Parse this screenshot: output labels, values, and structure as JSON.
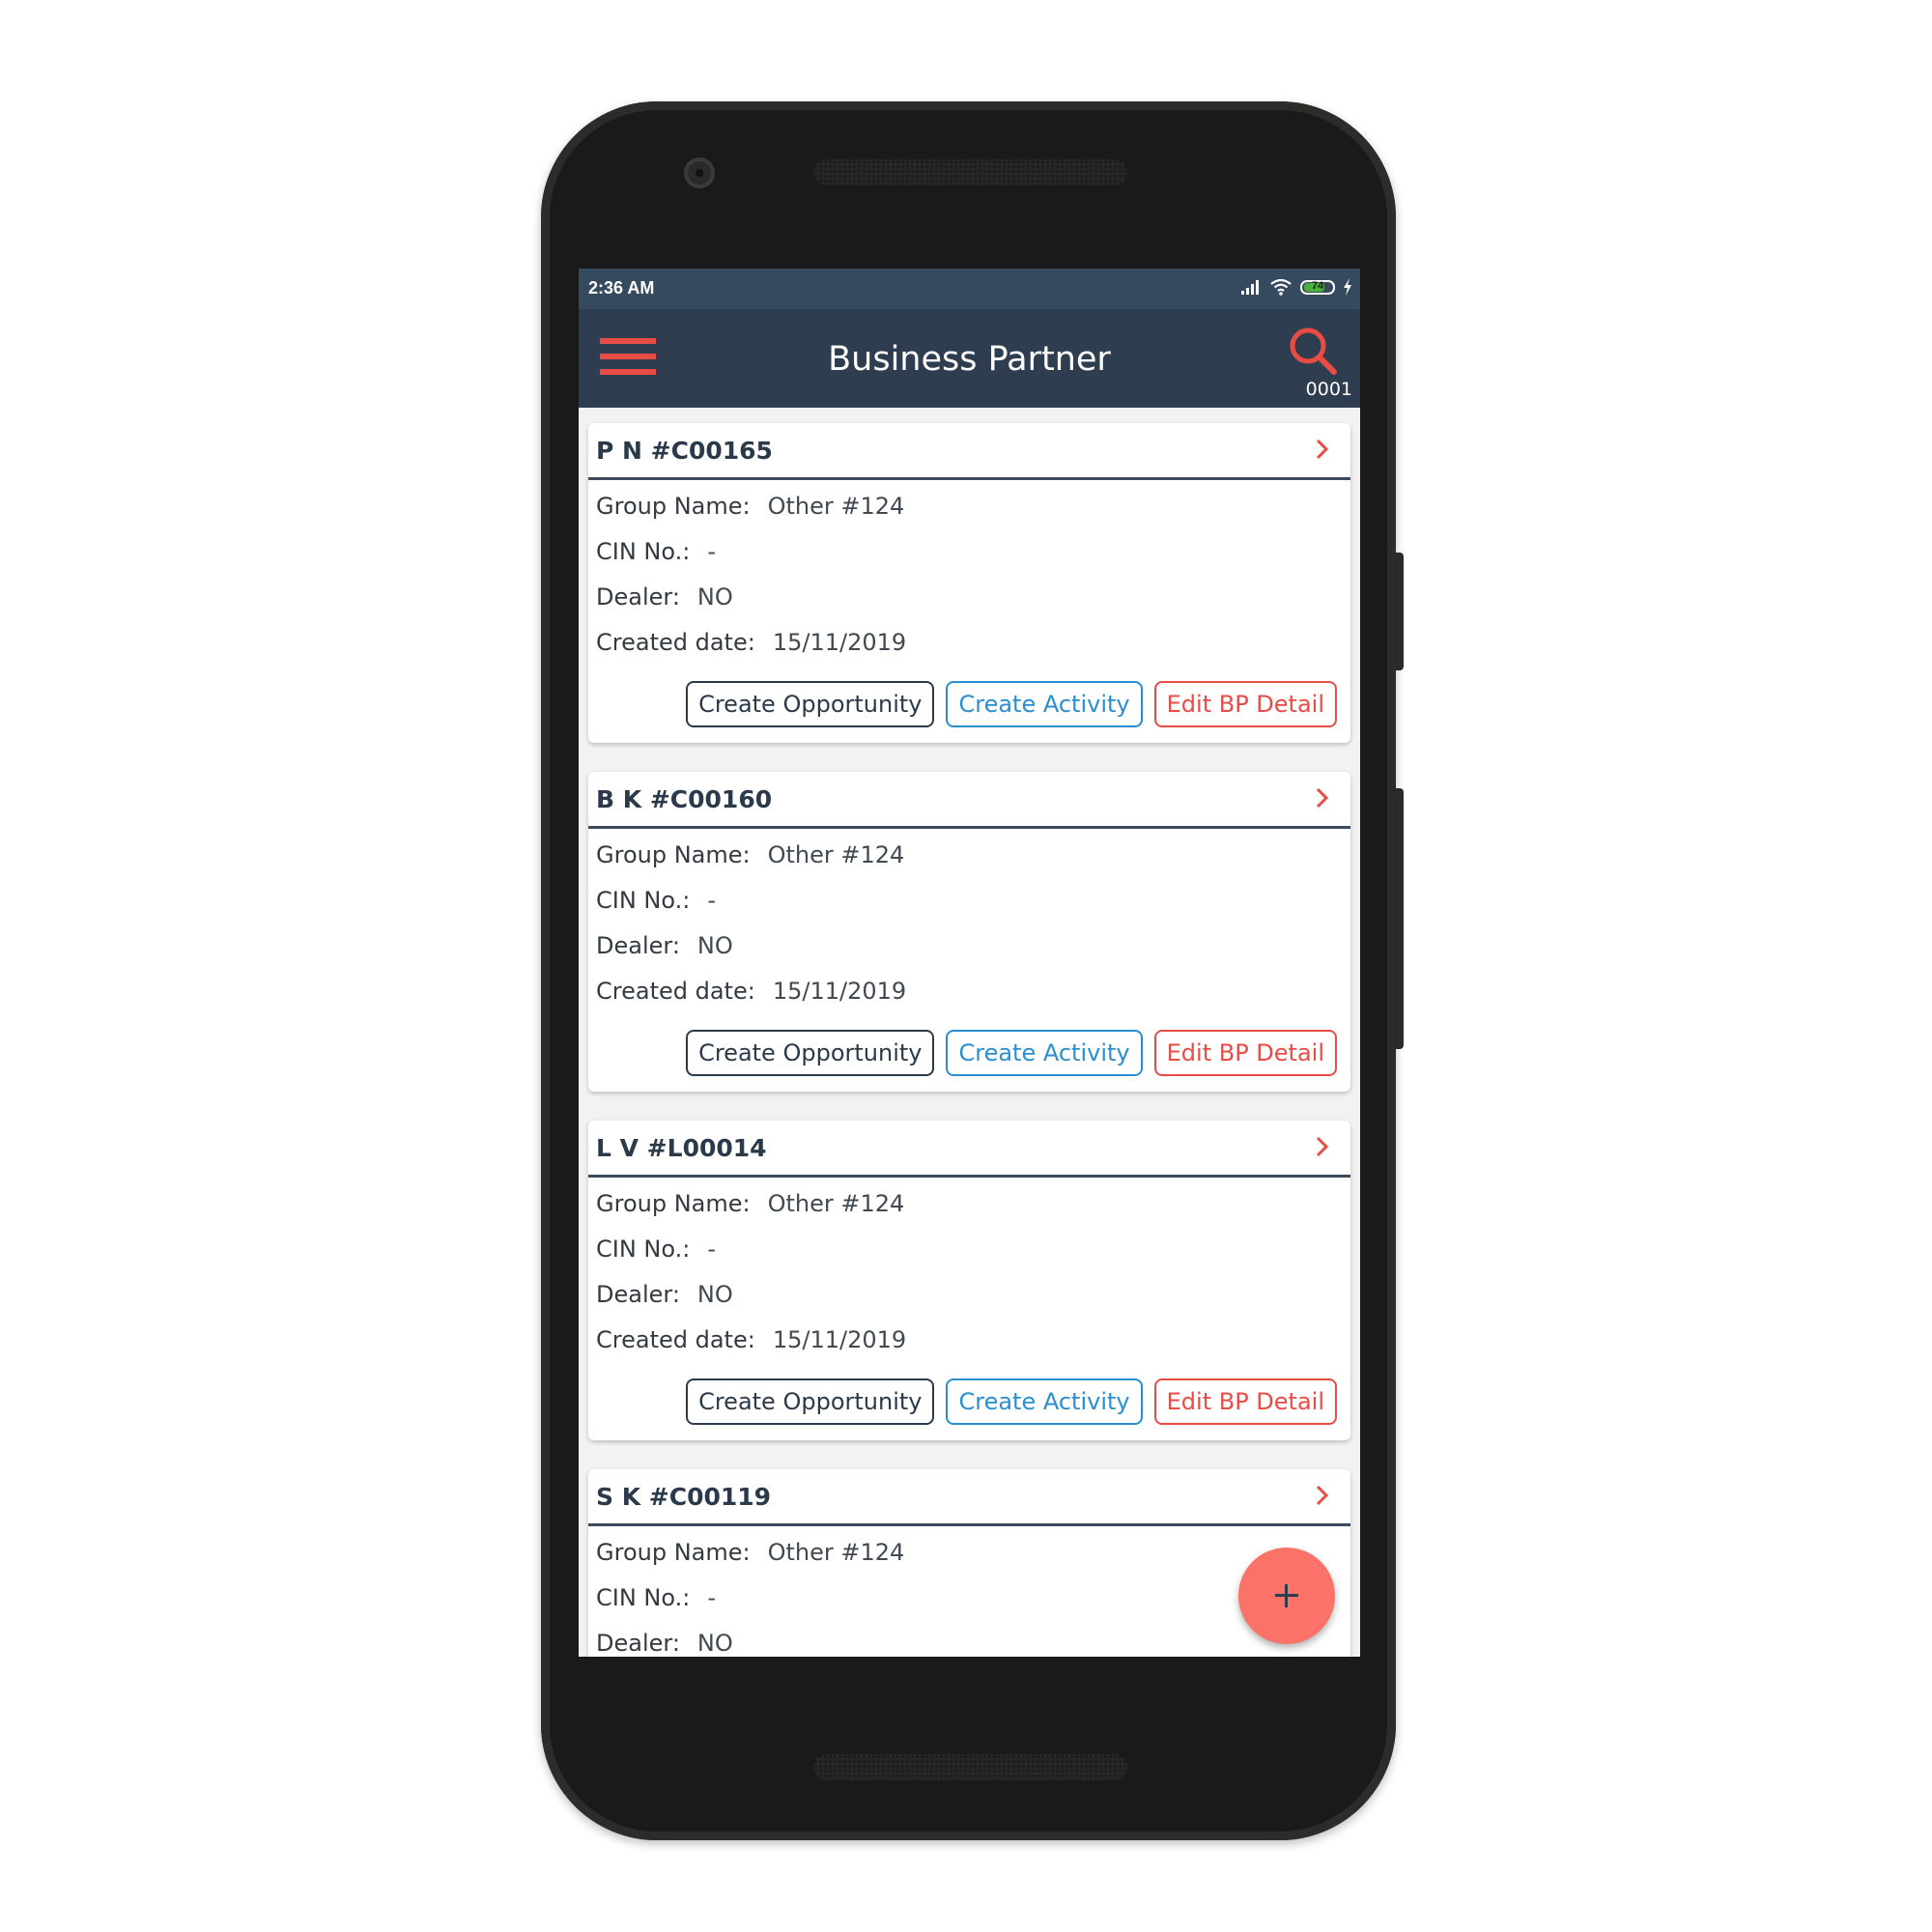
{
  "status_bar": {
    "time": "2:36 AM",
    "battery_percent": "74",
    "battery_level": 0.74,
    "icons": [
      "signal-icon",
      "wifi-icon",
      "battery-icon",
      "charging-icon"
    ]
  },
  "app_bar": {
    "menu_icon": "hamburger-menu-icon",
    "title": "Business Partner",
    "search_icon": "search-icon",
    "search_code": "0001"
  },
  "colors": {
    "status_bar_bg": "#354a5e",
    "app_bar_bg": "#2e3d4f",
    "accent_red": "#e94b45",
    "accent_blue": "#2a8fd1",
    "fab_bg": "#fa7268"
  },
  "labels": {
    "group_name": "Group Name:",
    "cin_no": "CIN No.:",
    "dealer": "Dealer:",
    "created_date": "Created date:",
    "create_opportunity": "Create Opportunity",
    "create_activity": "Create Activity",
    "edit_bp_detail": "Edit BP Detail"
  },
  "partners": [
    {
      "title": "P N #C00165",
      "group_name": "Other #124",
      "cin_no": "-",
      "dealer": "NO",
      "created_date": "15/11/2019"
    },
    {
      "title": "B K #C00160",
      "group_name": "Other #124",
      "cin_no": "-",
      "dealer": "NO",
      "created_date": "15/11/2019"
    },
    {
      "title": "L V #L00014",
      "group_name": "Other #124",
      "cin_no": "-",
      "dealer": "NO",
      "created_date": "15/11/2019"
    },
    {
      "title": "S K #C00119",
      "group_name": "Other #124",
      "cin_no": "-",
      "dealer": "NO"
    }
  ],
  "fab": {
    "icon": "plus-icon"
  }
}
